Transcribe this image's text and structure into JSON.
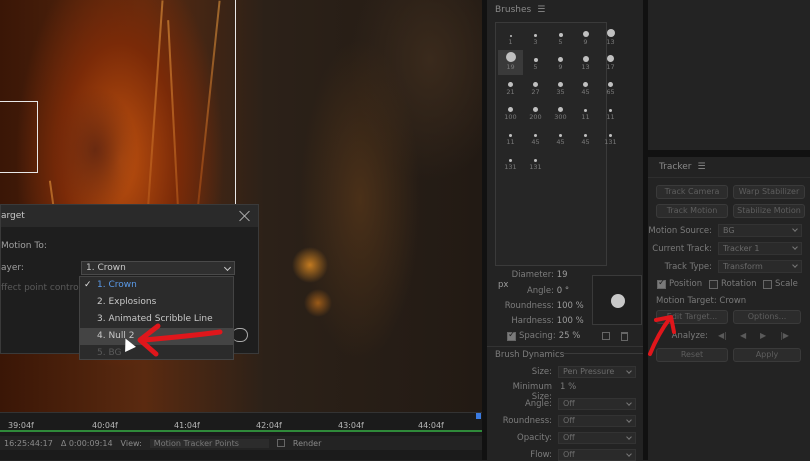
{
  "dialog": {
    "title": "arget",
    "section_label": "Motion To:",
    "layer_label": "ayer:",
    "effect_label": "ffect point control",
    "layer_value": "1. Crown",
    "options": [
      "1. Crown",
      "2. Explosions",
      "3. Animated Scribble Line",
      "4. Null 2",
      "5. BG"
    ],
    "selected_index": 0,
    "hover_index": 3
  },
  "timeline": {
    "ticks": [
      "39:04f",
      "40:04f",
      "41:04f",
      "42:04f",
      "43:04f",
      "44:04f"
    ],
    "status": {
      "timecode": "16:25:44:17",
      "delta": "Δ 0:00:09:14",
      "view_label": "View:",
      "view_value": "Motion Tracker Points",
      "render_label": "Render"
    }
  },
  "brushes": {
    "title": "Brushes",
    "sizes": [
      "1",
      "3",
      "5",
      "9",
      "13",
      "19",
      "5",
      "9",
      "13",
      "17",
      "21",
      "27",
      "35",
      "45",
      "65",
      "100",
      "200",
      "300",
      "11",
      "11",
      "11",
      "45",
      "45",
      "45",
      "131",
      "131",
      "131"
    ],
    "selected_index": 5,
    "props": {
      "diameter_label": "Diameter:",
      "diameter_value": "19 px",
      "angle_label": "Angle:",
      "angle_value": "0 °",
      "roundness_label": "Roundness:",
      "roundness_value": "100 %",
      "hardness_label": "Hardness:",
      "hardness_value": "100 %",
      "spacing_label": "Spacing:",
      "spacing_value": "25 %"
    },
    "dynamics": {
      "title": "Brush Dynamics",
      "size_label": "Size:",
      "size_value": "Pen Pressure",
      "min_size_label": "Minimum Size:",
      "min_size_value": "1 %",
      "angle_label": "Angle:",
      "angle_value": "Off",
      "roundness_label": "Roundness:",
      "roundness_value": "Off",
      "opacity_label": "Opacity:",
      "opacity_value": "Off",
      "flow_label": "Flow:",
      "flow_value": "Off"
    }
  },
  "tracker": {
    "title": "Tracker",
    "track_camera": "Track Camera",
    "warp_stabilizer": "Warp Stabilizer",
    "track_motion": "Track Motion",
    "stabilize_motion": "Stabilize Motion",
    "motion_source_label": "Motion Source:",
    "motion_source_value": "BG",
    "current_track_label": "Current Track:",
    "current_track_value": "Tracker 1",
    "track_type_label": "Track Type:",
    "track_type_value": "Transform",
    "position_label": "Position",
    "rotation_label": "Rotation",
    "scale_label": "Scale",
    "motion_target_label": "Motion Target:",
    "motion_target_value": "Crown",
    "edit_target": "Edit Target...",
    "options": "Options...",
    "analyze_label": "Analyze:",
    "reset": "Reset",
    "apply": "Apply"
  },
  "colors": {
    "annotation_arrow": "#e0161b",
    "accent_blue": "#5a9ae8",
    "timeline_green": "#2f8a3a"
  }
}
